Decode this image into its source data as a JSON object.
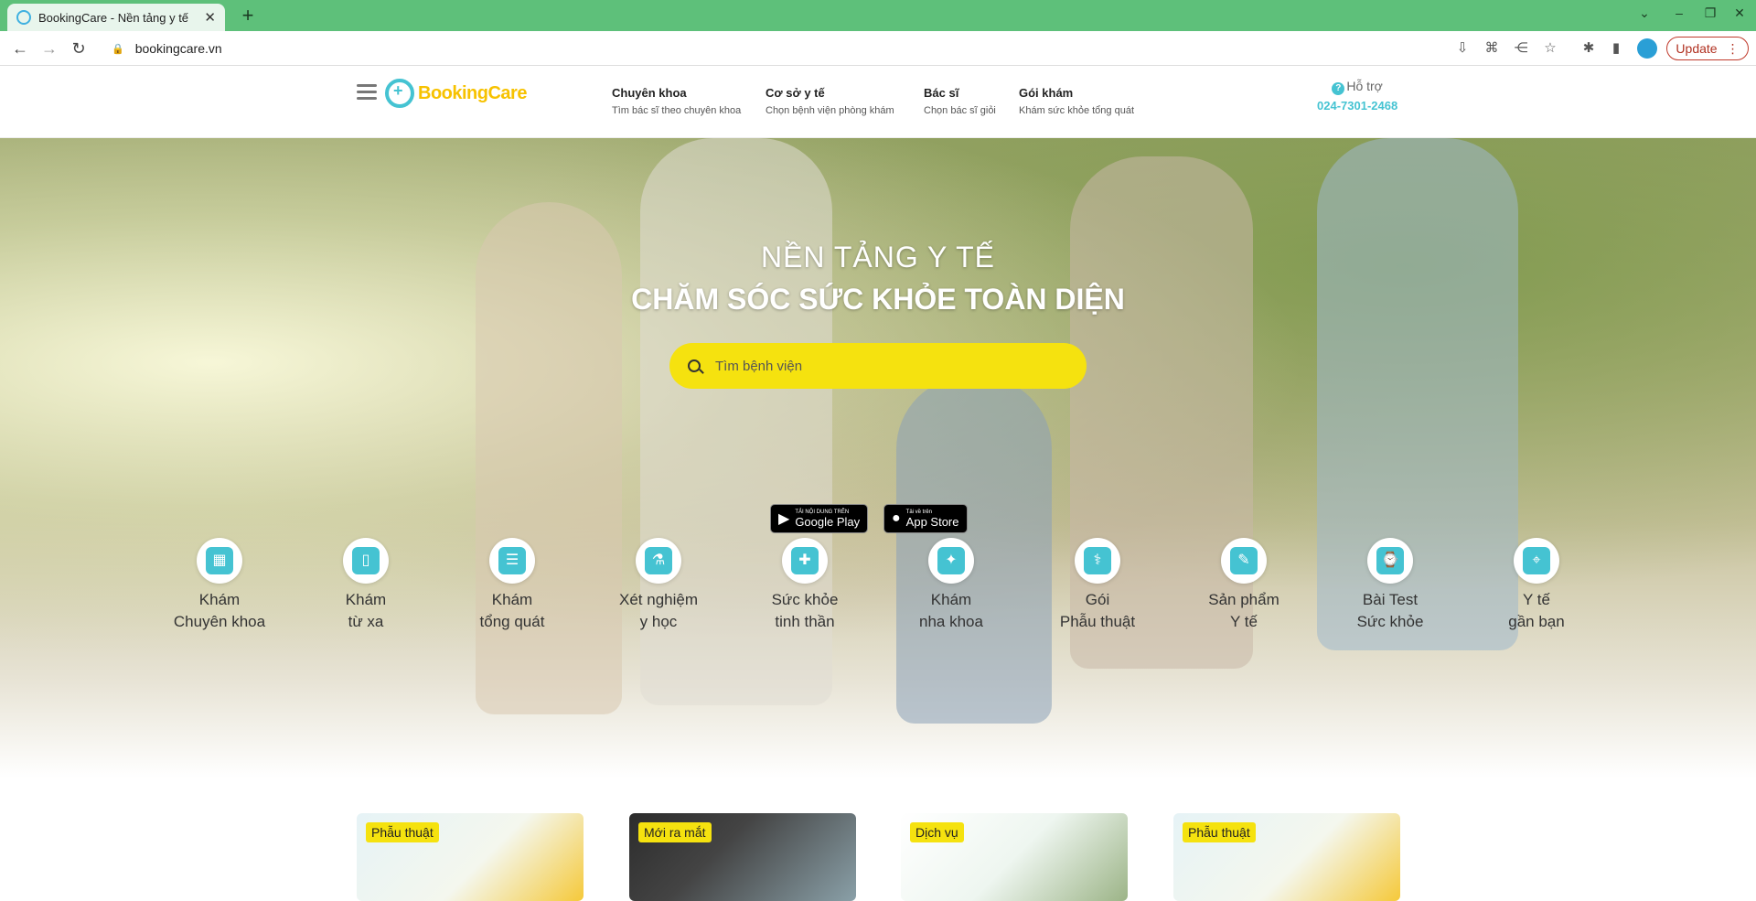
{
  "browser": {
    "tab_title": "BookingCare - Nền tảng y tế",
    "url": "bookingcare.vn",
    "update_label": "Update"
  },
  "header": {
    "logo_text": "BookingCare",
    "nav": [
      {
        "main": "Chuyên khoa",
        "sub": "Tìm bác sĩ theo chuyên khoa"
      },
      {
        "main": "Cơ sở y tế",
        "sub": "Chọn bệnh viện phòng khám"
      },
      {
        "main": "Bác sĩ",
        "sub": "Chọn bác sĩ giỏi"
      },
      {
        "main": "Gói khám",
        "sub": "Khám sức khỏe tổng quát"
      }
    ],
    "support_label": "Hỗ trợ",
    "support_phone": "024-7301-2468"
  },
  "hero": {
    "title_line1": "NỀN TẢNG Y TẾ",
    "title_line2": "CHĂM SÓC SỨC KHỎE TOÀN DIỆN",
    "search_placeholder": "Tìm bệnh viện",
    "google_play": {
      "small": "TẢI NỘI DUNG TRÊN",
      "big": "Google Play"
    },
    "app_store": {
      "small": "Tải về trên",
      "big": "App Store"
    }
  },
  "categories": [
    {
      "l1": "Khám",
      "l2": "Chuyên khoa",
      "icon": "hospital-icon"
    },
    {
      "l1": "Khám",
      "l2": "từ xa",
      "icon": "phone-icon"
    },
    {
      "l1": "Khám",
      "l2": "tổng quát",
      "icon": "clipboard-icon"
    },
    {
      "l1": "Xét nghiệm",
      "l2": "y học",
      "icon": "test-tube-icon"
    },
    {
      "l1": "Sức khỏe",
      "l2": "tinh thần",
      "icon": "head-icon"
    },
    {
      "l1": "Khám",
      "l2": "nha khoa",
      "icon": "tooth-icon"
    },
    {
      "l1": "Gói",
      "l2": "Phẫu thuật",
      "icon": "surgery-icon"
    },
    {
      "l1": "Sản phẩm",
      "l2": "Y tế",
      "icon": "product-icon"
    },
    {
      "l1": "Bài Test",
      "l2": "Sức khỏe",
      "icon": "watch-icon"
    },
    {
      "l1": "Y tế",
      "l2": "gần bạn",
      "icon": "location-icon"
    }
  ],
  "cards": [
    {
      "badge": "Phẫu thuật"
    },
    {
      "badge": "Mới ra mắt"
    },
    {
      "badge": "Dịch vụ"
    },
    {
      "badge": "Phẫu thuật"
    }
  ],
  "colors": {
    "accent": "#45c3d2",
    "brand_yellow": "#f7c200",
    "search_yellow": "#f5e20f",
    "browser_green": "#5ec07a"
  }
}
